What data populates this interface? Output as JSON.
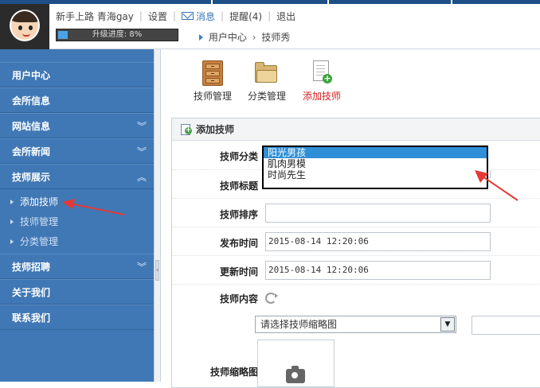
{
  "header": {
    "user_links": {
      "username": "新手上路 青海gay",
      "settings": "设置",
      "messages": "消息",
      "reminders": "提醒(4)",
      "logout": "退出"
    },
    "progress": {
      "label": "升级进度: 8%",
      "value": 8
    },
    "breadcrumb": {
      "root": "用户中心",
      "current": "技师秀"
    }
  },
  "sidebar": {
    "items": [
      {
        "label": "用户中心",
        "chevron": ""
      },
      {
        "label": "会所信息",
        "chevron": ""
      },
      {
        "label": "网站信息",
        "chevron": "︾"
      },
      {
        "label": "会所新闻",
        "chevron": "︾"
      },
      {
        "label": "技师展示",
        "chevron": "︽"
      },
      {
        "label": "技师招聘",
        "chevron": "︾"
      },
      {
        "label": "关于我们",
        "chevron": ""
      },
      {
        "label": "联系我们",
        "chevron": ""
      }
    ],
    "sub_items": [
      {
        "label": "添加技师"
      },
      {
        "label": "技师管理"
      },
      {
        "label": "分类管理"
      }
    ]
  },
  "toolbar": {
    "manage_label": "技师管理",
    "category_label": "分类管理",
    "add_label": "添加技师"
  },
  "form": {
    "title": "添加技师",
    "category_label": "技师分类",
    "category_options": [
      "阳光男孩",
      "肌肉男模",
      "时尚先生"
    ],
    "title_label": "技师标题",
    "sort_label": "技师排序",
    "publish_label": "发布时间",
    "publish_value": "2015-08-14 12:20:06",
    "update_label": "更新时间",
    "update_value": "2015-08-14 12:20:06",
    "content_label": "技师内容",
    "thumb_select_value": "请选择技师缩略图",
    "thumb_label": "技师缩略图"
  },
  "colors": {
    "sidebar_bg": "#4078b5",
    "accent_red": "#d32020",
    "selected_option": "#2f8fd6",
    "top_strip": "#1e4f86"
  }
}
